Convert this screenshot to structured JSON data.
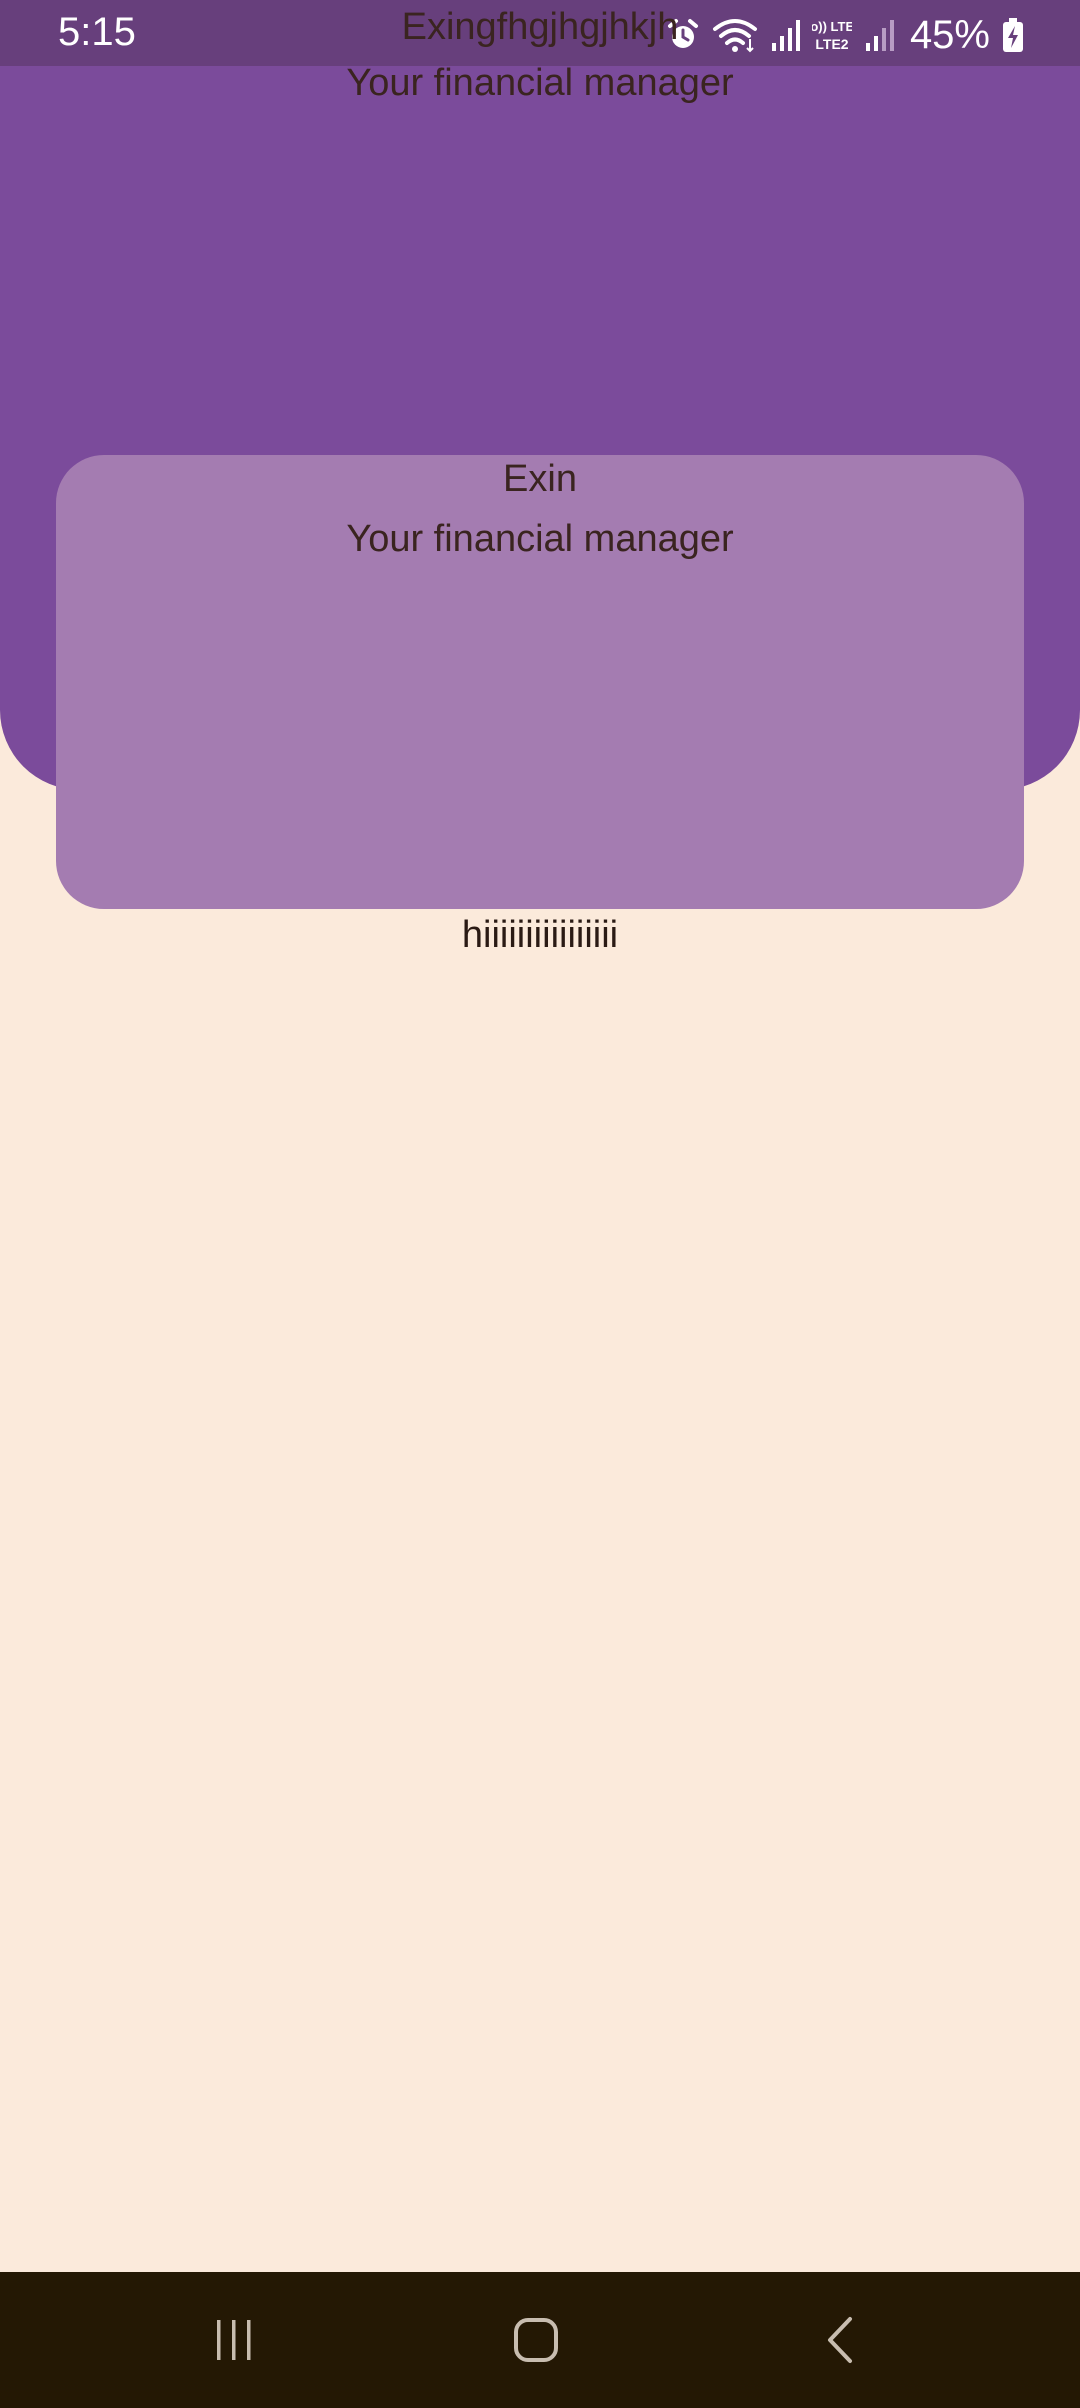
{
  "status_bar": {
    "time": "5:15",
    "battery_percent": "45%",
    "network_label": "Vo)) LTE2",
    "icons": [
      "alarm-icon",
      "wifi-icon",
      "signal-icon",
      "volte-icon",
      "signal-icon",
      "battery-charging-icon"
    ]
  },
  "header": {
    "title": "Exingfhgjhgjhkjh",
    "subtitle": "Your financial manager"
  },
  "card": {
    "title": "Exin",
    "subtitle": "Your financial manager"
  },
  "body": {
    "text": "hiiiiiiiiiiiiiiii"
  },
  "nav_bar": {
    "icons": [
      "recents-icon",
      "home-icon",
      "back-icon"
    ]
  },
  "colors": {
    "background": "#fbeadb",
    "header": "#7b4b9b",
    "status_bar": "#673f7c",
    "card": "#a47cb1",
    "text": "#3a2420",
    "nav_bar": "#241804"
  }
}
